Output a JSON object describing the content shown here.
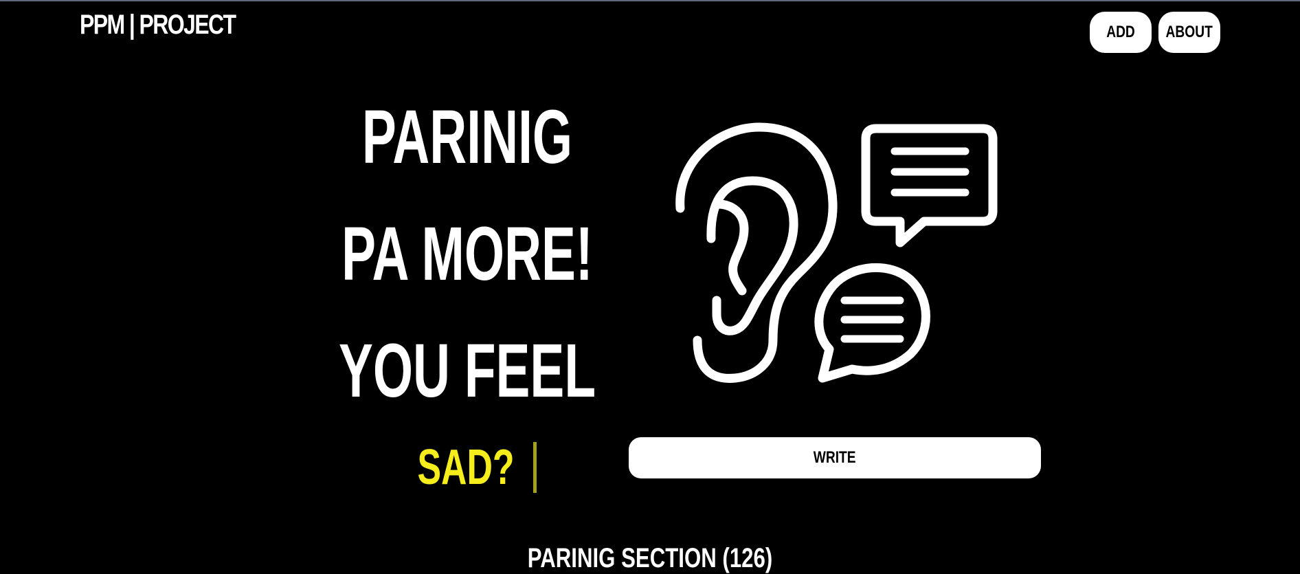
{
  "header": {
    "brand": "PPM | PROJECT",
    "nav": {
      "add_label": "ADD",
      "about_label": "ABOUT"
    }
  },
  "hero": {
    "line1": "PARINIG",
    "line2": "PA MORE!",
    "line3": "YOU FEEL",
    "typed_word": "SAD?",
    "typed_color": "#f5ee1c",
    "illustration_icon": "ear-with-speech-bubbles-icon",
    "write_label": "WRITE"
  },
  "section": {
    "title": "PARINIG SECTION (126)"
  },
  "colors": {
    "background": "#000000",
    "text": "#ffffff",
    "accent": "#f5ee1c"
  }
}
